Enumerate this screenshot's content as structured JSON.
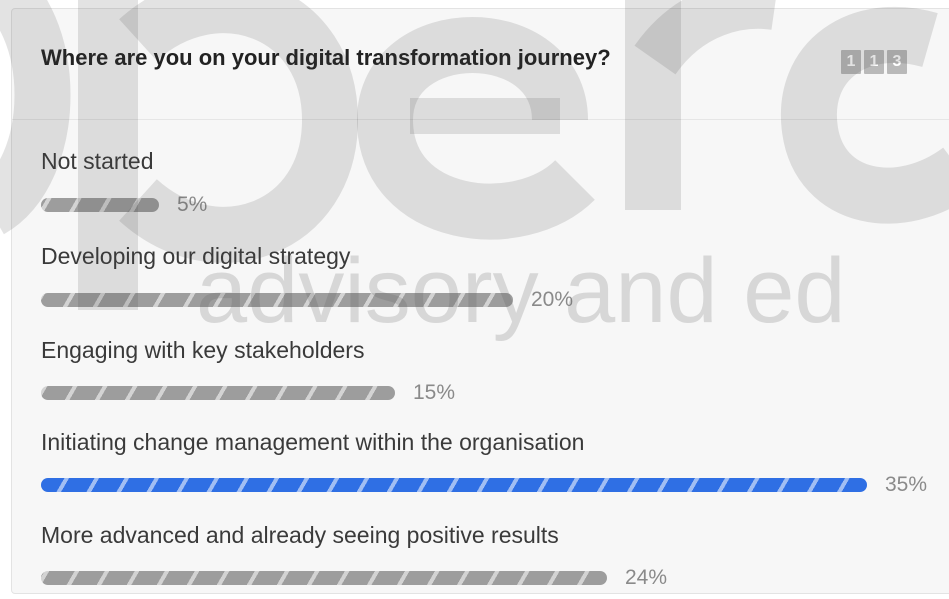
{
  "poll": {
    "question": "Where are you on your digital transformation journey?",
    "vote_digits": [
      "1",
      "1",
      "3"
    ],
    "options": [
      {
        "label": "Not started",
        "percent_label": "5%",
        "fraction": 0.05,
        "selected": false
      },
      {
        "label": "Developing our digital strategy",
        "percent_label": "20%",
        "fraction": 0.2,
        "selected": false
      },
      {
        "label": "Engaging with key stakeholders",
        "percent_label": "15%",
        "fraction": 0.15,
        "selected": false
      },
      {
        "label": "Initiating change management within the organisation",
        "percent_label": "35%",
        "fraction": 0.35,
        "selected": true
      },
      {
        "label": "More advanced and already seeing positive results",
        "percent_label": "24%",
        "fraction": 0.24,
        "selected": false
      }
    ]
  },
  "watermark": {
    "logo_text": "opera",
    "tagline": "advisory and ed"
  },
  "colors": {
    "accent": "#2f6fe4",
    "bar_default": "#9d9d9d",
    "background": "#f7f7f7"
  }
}
